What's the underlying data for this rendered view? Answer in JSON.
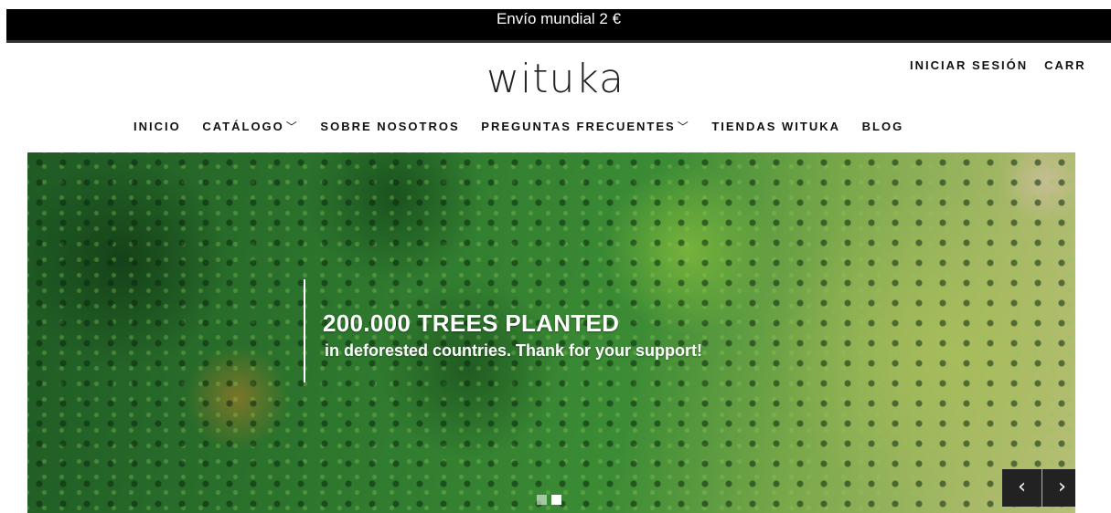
{
  "announcement": "Envío mundial 2 €",
  "logo": "wituka",
  "account": {
    "login": "INICIAR SESIÓN",
    "cart": "CARR"
  },
  "nav": {
    "items": [
      {
        "label": "INICIO"
      },
      {
        "label": "CATÁLOGO",
        "dropdown": true
      },
      {
        "label": "SOBRE NOSOTROS"
      },
      {
        "label": "PREGUNTAS FRECUENTES",
        "dropdown": true
      },
      {
        "label": "TIENDAS WITUKA"
      },
      {
        "label": "BLOG"
      }
    ],
    "dropdown_icon": "chevron-down-icon"
  },
  "hero": {
    "headline": "200.000 TREES PLANTED",
    "subtext": "in deforested countries. Thank for your support!",
    "slides_total": 2,
    "active_slide": 2,
    "prev_arrow": "‹",
    "next_arrow": "›"
  },
  "colors": {
    "announcement_bg": "#000000",
    "text": "#111111",
    "arrow_bg": "#222222"
  }
}
